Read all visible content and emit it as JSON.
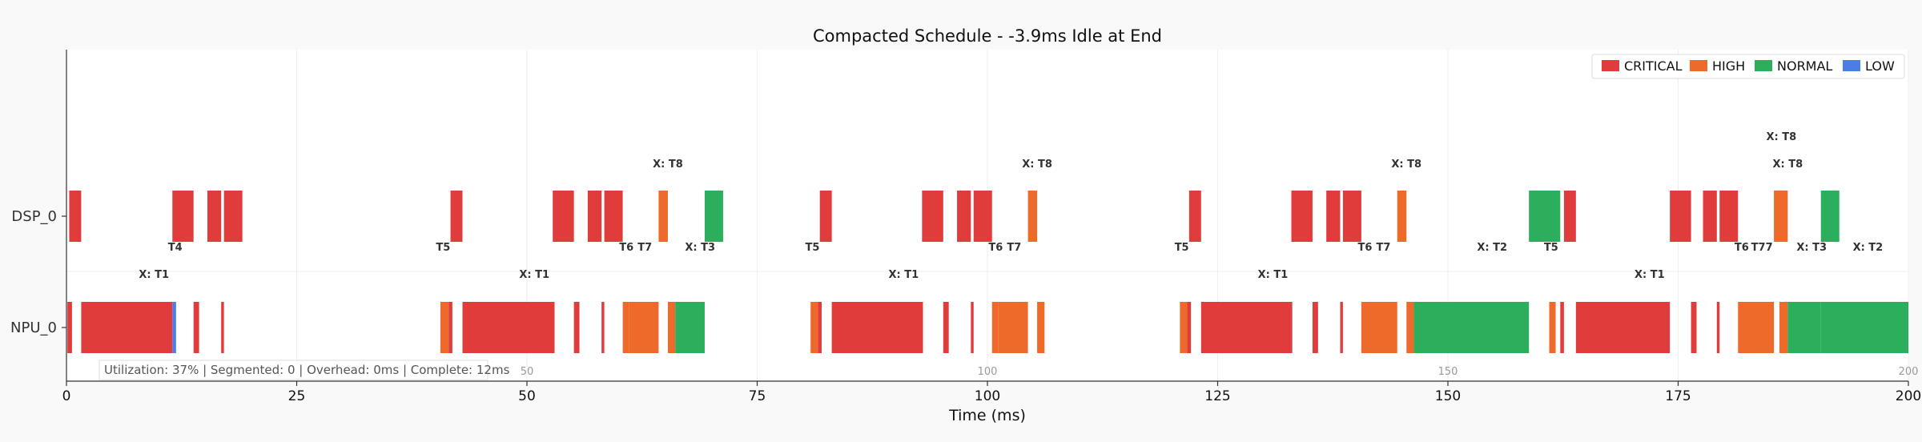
{
  "title": "Compacted Schedule - -3.9ms Idle at End",
  "chart_data": {
    "type": "gantt",
    "title": "Compacted Schedule - -3.9ms Idle at End",
    "xlabel": "Time (ms)",
    "xlim": [
      0,
      200
    ],
    "xticks": [
      0,
      25,
      50,
      75,
      100,
      125,
      150,
      175,
      200
    ],
    "resources": [
      "DSP_0",
      "NPU_0"
    ],
    "colors": {
      "CRITICAL": "#e03c3c",
      "HIGH": "#ed6a2b",
      "NORMAL": "#2caf5c",
      "LOW": "#4a7ee6"
    },
    "legend": {
      "position": "top-right",
      "entries": [
        "CRITICAL",
        "HIGH",
        "NORMAL",
        "LOW"
      ]
    },
    "tasks": [
      {
        "resource": "DSP_0",
        "start": 0.3,
        "end": 1.6,
        "priority": "CRITICAL"
      },
      {
        "resource": "DSP_0",
        "start": 11.5,
        "end": 13.8,
        "priority": "CRITICAL"
      },
      {
        "resource": "DSP_0",
        "start": 15.3,
        "end": 16.8,
        "priority": "CRITICAL"
      },
      {
        "resource": "DSP_0",
        "start": 17.1,
        "end": 19.1,
        "priority": "CRITICAL"
      },
      {
        "resource": "DSP_0",
        "start": 41.7,
        "end": 43.0,
        "priority": "CRITICAL"
      },
      {
        "resource": "DSP_0",
        "start": 52.8,
        "end": 55.1,
        "priority": "CRITICAL"
      },
      {
        "resource": "DSP_0",
        "start": 56.6,
        "end": 58.1,
        "priority": "CRITICAL"
      },
      {
        "resource": "DSP_0",
        "start": 58.4,
        "end": 60.4,
        "priority": "CRITICAL"
      },
      {
        "resource": "DSP_0",
        "start": 64.3,
        "end": 65.3,
        "priority": "HIGH"
      },
      {
        "resource": "DSP_0",
        "start": 69.3,
        "end": 71.3,
        "priority": "NORMAL"
      },
      {
        "resource": "DSP_0",
        "start": 81.8,
        "end": 83.1,
        "priority": "CRITICAL"
      },
      {
        "resource": "DSP_0",
        "start": 92.9,
        "end": 95.2,
        "priority": "CRITICAL"
      },
      {
        "resource": "DSP_0",
        "start": 96.7,
        "end": 98.2,
        "priority": "CRITICAL"
      },
      {
        "resource": "DSP_0",
        "start": 98.5,
        "end": 100.5,
        "priority": "CRITICAL"
      },
      {
        "resource": "DSP_0",
        "start": 104.4,
        "end": 105.4,
        "priority": "HIGH"
      },
      {
        "resource": "DSP_0",
        "start": 121.9,
        "end": 123.2,
        "priority": "CRITICAL"
      },
      {
        "resource": "DSP_0",
        "start": 133.0,
        "end": 135.3,
        "priority": "CRITICAL"
      },
      {
        "resource": "DSP_0",
        "start": 136.8,
        "end": 138.3,
        "priority": "CRITICAL"
      },
      {
        "resource": "DSP_0",
        "start": 138.6,
        "end": 140.6,
        "priority": "CRITICAL"
      },
      {
        "resource": "DSP_0",
        "start": 144.5,
        "end": 145.5,
        "priority": "HIGH"
      },
      {
        "resource": "DSP_0",
        "start": 158.8,
        "end": 162.2,
        "priority": "NORMAL"
      },
      {
        "resource": "DSP_0",
        "start": 162.6,
        "end": 163.9,
        "priority": "CRITICAL"
      },
      {
        "resource": "DSP_0",
        "start": 174.1,
        "end": 176.4,
        "priority": "CRITICAL"
      },
      {
        "resource": "DSP_0",
        "start": 177.7,
        "end": 179.2,
        "priority": "CRITICAL"
      },
      {
        "resource": "DSP_0",
        "start": 179.5,
        "end": 181.5,
        "priority": "CRITICAL"
      },
      {
        "resource": "DSP_0",
        "start": 185.4,
        "end": 186.9,
        "priority": "HIGH"
      },
      {
        "resource": "DSP_0",
        "start": 190.5,
        "end": 192.5,
        "priority": "NORMAL"
      },
      {
        "resource": "NPU_0",
        "start": 0.1,
        "end": 0.6,
        "priority": "CRITICAL"
      },
      {
        "resource": "NPU_0",
        "start": 1.6,
        "end": 11.5,
        "priority": "CRITICAL"
      },
      {
        "resource": "NPU_0",
        "start": 11.5,
        "end": 11.9,
        "priority": "LOW"
      },
      {
        "resource": "NPU_0",
        "start": 13.8,
        "end": 14.4,
        "priority": "CRITICAL"
      },
      {
        "resource": "NPU_0",
        "start": 16.8,
        "end": 17.1,
        "priority": "CRITICAL"
      },
      {
        "resource": "NPU_0",
        "start": 40.6,
        "end": 41.5,
        "priority": "HIGH"
      },
      {
        "resource": "NPU_0",
        "start": 41.5,
        "end": 41.9,
        "priority": "CRITICAL"
      },
      {
        "resource": "NPU_0",
        "start": 43.0,
        "end": 53.0,
        "priority": "CRITICAL"
      },
      {
        "resource": "NPU_0",
        "start": 55.1,
        "end": 55.7,
        "priority": "CRITICAL"
      },
      {
        "resource": "NPU_0",
        "start": 58.1,
        "end": 58.4,
        "priority": "CRITICAL"
      },
      {
        "resource": "NPU_0",
        "start": 60.4,
        "end": 61.1,
        "priority": "HIGH"
      },
      {
        "resource": "NPU_0",
        "start": 61.1,
        "end": 64.3,
        "priority": "HIGH"
      },
      {
        "resource": "NPU_0",
        "start": 65.3,
        "end": 66.1,
        "priority": "HIGH"
      },
      {
        "resource": "NPU_0",
        "start": 66.1,
        "end": 69.3,
        "priority": "NORMAL"
      },
      {
        "resource": "NPU_0",
        "start": 80.8,
        "end": 81.6,
        "priority": "HIGH"
      },
      {
        "resource": "NPU_0",
        "start": 81.6,
        "end": 82.0,
        "priority": "CRITICAL"
      },
      {
        "resource": "NPU_0",
        "start": 83.1,
        "end": 93.0,
        "priority": "CRITICAL"
      },
      {
        "resource": "NPU_0",
        "start": 95.2,
        "end": 95.8,
        "priority": "CRITICAL"
      },
      {
        "resource": "NPU_0",
        "start": 98.2,
        "end": 98.5,
        "priority": "CRITICAL"
      },
      {
        "resource": "NPU_0",
        "start": 100.5,
        "end": 101.2,
        "priority": "HIGH"
      },
      {
        "resource": "NPU_0",
        "start": 101.2,
        "end": 104.4,
        "priority": "HIGH"
      },
      {
        "resource": "NPU_0",
        "start": 105.4,
        "end": 106.2,
        "priority": "HIGH"
      },
      {
        "resource": "NPU_0",
        "start": 120.9,
        "end": 121.7,
        "priority": "HIGH"
      },
      {
        "resource": "NPU_0",
        "start": 121.7,
        "end": 122.1,
        "priority": "CRITICAL"
      },
      {
        "resource": "NPU_0",
        "start": 123.2,
        "end": 133.1,
        "priority": "CRITICAL"
      },
      {
        "resource": "NPU_0",
        "start": 135.3,
        "end": 135.9,
        "priority": "CRITICAL"
      },
      {
        "resource": "NPU_0",
        "start": 138.3,
        "end": 138.6,
        "priority": "CRITICAL"
      },
      {
        "resource": "NPU_0",
        "start": 140.6,
        "end": 144.5,
        "priority": "HIGH"
      },
      {
        "resource": "NPU_0",
        "start": 145.5,
        "end": 146.3,
        "priority": "HIGH"
      },
      {
        "resource": "NPU_0",
        "start": 146.3,
        "end": 158.8,
        "priority": "NORMAL"
      },
      {
        "resource": "NPU_0",
        "start": 161.0,
        "end": 161.7,
        "priority": "HIGH"
      },
      {
        "resource": "NPU_0",
        "start": 162.2,
        "end": 162.6,
        "priority": "CRITICAL"
      },
      {
        "resource": "NPU_0",
        "start": 163.9,
        "end": 174.1,
        "priority": "CRITICAL"
      },
      {
        "resource": "NPU_0",
        "start": 176.4,
        "end": 177.0,
        "priority": "CRITICAL"
      },
      {
        "resource": "NPU_0",
        "start": 179.2,
        "end": 179.5,
        "priority": "CRITICAL"
      },
      {
        "resource": "NPU_0",
        "start": 181.5,
        "end": 185.4,
        "priority": "HIGH"
      },
      {
        "resource": "NPU_0",
        "start": 186.0,
        "end": 186.9,
        "priority": "HIGH"
      },
      {
        "resource": "NPU_0",
        "start": 186.9,
        "end": 190.5,
        "priority": "NORMAL"
      },
      {
        "resource": "NPU_0",
        "start": 190.5,
        "end": 200.0,
        "priority": "NORMAL"
      }
    ],
    "annotations": [
      {
        "text": "X: T8",
        "x": 65.3,
        "resource": "DSP_0",
        "pos": "above"
      },
      {
        "text": "X: T8",
        "x": 105.4,
        "resource": "DSP_0",
        "pos": "above"
      },
      {
        "text": "X: T8",
        "x": 145.5,
        "resource": "DSP_0",
        "pos": "above"
      },
      {
        "text": "X: T8",
        "x": 186.9,
        "resource": "DSP_0",
        "pos": "above"
      },
      {
        "text": "X: T8",
        "x": 186.2,
        "resource": "DSP_0",
        "pos": "above2"
      },
      {
        "text": "T4",
        "x": 11.8,
        "resource": "DSP_0",
        "pos": "below"
      },
      {
        "text": "T5",
        "x": 40.9,
        "resource": "DSP_0",
        "pos": "below"
      },
      {
        "text": "T6",
        "x": 60.8,
        "resource": "DSP_0",
        "pos": "below"
      },
      {
        "text": "T7",
        "x": 62.8,
        "resource": "DSP_0",
        "pos": "below"
      },
      {
        "text": "X: T3",
        "x": 68.8,
        "resource": "DSP_0",
        "pos": "below"
      },
      {
        "text": "T5",
        "x": 81.0,
        "resource": "DSP_0",
        "pos": "below"
      },
      {
        "text": "T6",
        "x": 100.9,
        "resource": "DSP_0",
        "pos": "below"
      },
      {
        "text": "T7",
        "x": 102.9,
        "resource": "DSP_0",
        "pos": "below"
      },
      {
        "text": "T5",
        "x": 121.1,
        "resource": "DSP_0",
        "pos": "below"
      },
      {
        "text": "T6",
        "x": 141.0,
        "resource": "DSP_0",
        "pos": "below"
      },
      {
        "text": "T7",
        "x": 143.0,
        "resource": "DSP_0",
        "pos": "below"
      },
      {
        "text": "X: T2",
        "x": 154.8,
        "resource": "DSP_0",
        "pos": "below"
      },
      {
        "text": "T5",
        "x": 161.2,
        "resource": "DSP_0",
        "pos": "below"
      },
      {
        "text": "T6",
        "x": 181.9,
        "resource": "DSP_0",
        "pos": "below"
      },
      {
        "text": "T77",
        "x": 184.1,
        "resource": "DSP_0",
        "pos": "below"
      },
      {
        "text": "X: T3",
        "x": 189.5,
        "resource": "DSP_0",
        "pos": "below"
      },
      {
        "text": "X: T2",
        "x": 195.6,
        "resource": "DSP_0",
        "pos": "below"
      },
      {
        "text": "X: T1",
        "x": 9.5,
        "resource": "NPU_0",
        "pos": "above"
      },
      {
        "text": "X: T1",
        "x": 50.8,
        "resource": "NPU_0",
        "pos": "above"
      },
      {
        "text": "X: T1",
        "x": 90.9,
        "resource": "NPU_0",
        "pos": "above"
      },
      {
        "text": "X: T1",
        "x": 131.0,
        "resource": "NPU_0",
        "pos": "above"
      },
      {
        "text": "X: T1",
        "x": 171.9,
        "resource": "NPU_0",
        "pos": "above"
      }
    ],
    "secondary_ticks": [
      50,
      100,
      150,
      200
    ],
    "info_box": "Utilization: 37% | Segmented: 0 | Overhead: 0ms | Complete: 12ms"
  }
}
